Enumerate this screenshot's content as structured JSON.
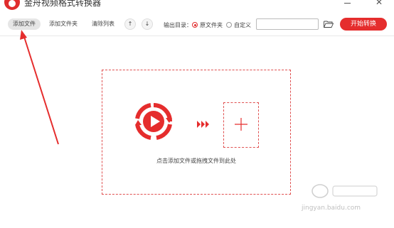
{
  "app": {
    "title": "金舟视频格式转换器"
  },
  "toolbar": {
    "add_file": "添加文件",
    "add_folder": "添加文件夹",
    "clear_list": "清除列表",
    "move_up": "↑",
    "move_down": "↓",
    "output_label": "输出目录：",
    "output_options": [
      {
        "label": "原文件夹",
        "selected": true
      },
      {
        "label": "自定义",
        "selected": false
      }
    ],
    "output_path_value": "",
    "start_label": "开始转换"
  },
  "drop_zone": {
    "hint": "点击添加文件或拖拽文件到此处"
  },
  "watermark": {
    "text": "jingyan.baidu.com"
  },
  "colors": {
    "accent": "#e52d2d",
    "dashed_border": "#e05050"
  }
}
